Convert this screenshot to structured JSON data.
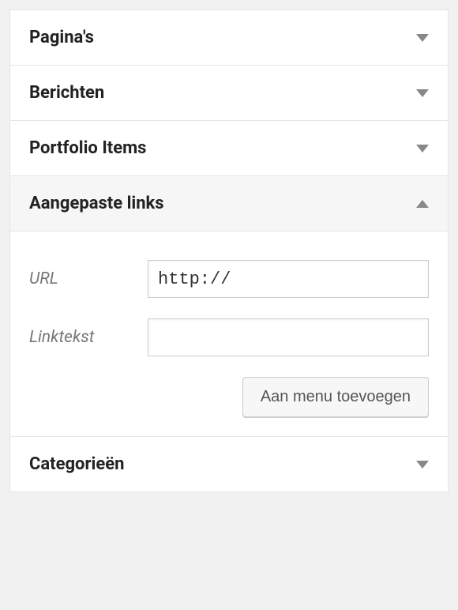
{
  "panels": {
    "pages": {
      "title": "Pagina's",
      "expanded": false
    },
    "posts": {
      "title": "Berichten",
      "expanded": false
    },
    "portfolio": {
      "title": "Portfolio Items",
      "expanded": false
    },
    "custom_links": {
      "title": "Aangepaste links",
      "expanded": true,
      "url_label": "URL",
      "url_value": "http://",
      "linktext_label": "Linktekst",
      "linktext_value": "",
      "add_button": "Aan menu toevoegen"
    },
    "categories": {
      "title": "Categorieën",
      "expanded": false
    }
  }
}
